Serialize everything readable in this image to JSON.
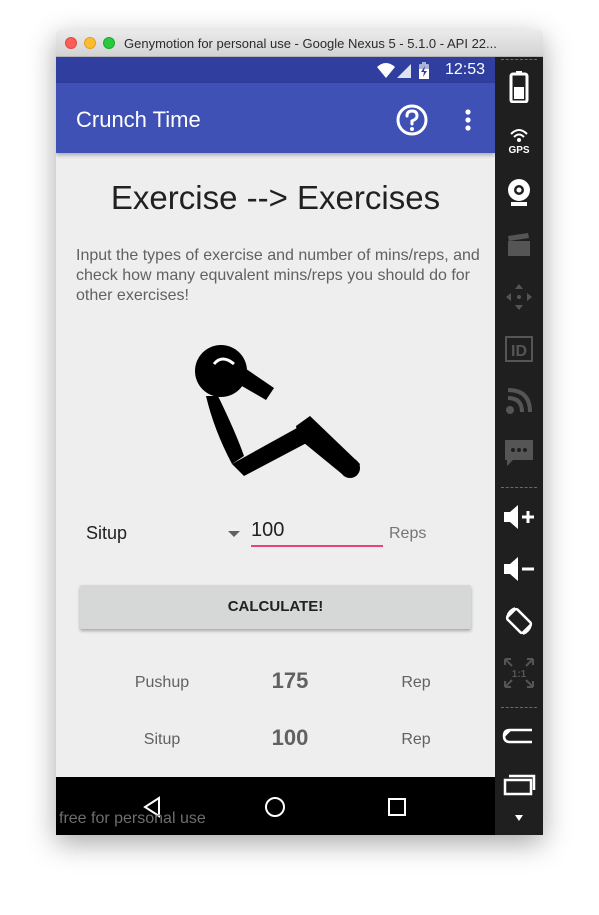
{
  "window": {
    "title": "Genymotion for personal use - Google Nexus 5 - 5.1.0 - API 22..."
  },
  "statusbar": {
    "time": "12:53"
  },
  "appbar": {
    "title": "Crunch Time",
    "help_icon": "help-circle-icon",
    "overflow_icon": "more-vert-icon"
  },
  "main": {
    "heading": "Exercise --> Exercises",
    "description": "Input the types of exercise and number of mins/reps, and check how many equvalent mins/reps you should do for other exercises!",
    "illustration_icon": "situp-figure-icon",
    "exercise_select": {
      "selected": "Situp"
    },
    "amount_input": {
      "value": "100"
    },
    "unit_label": "Reps",
    "calculate_button": "CALCULATE!",
    "results": [
      {
        "exercise": "Pushup",
        "value": "175",
        "unit": "Rep"
      },
      {
        "exercise": "Situp",
        "value": "100",
        "unit": "Rep"
      }
    ]
  },
  "navbar": {
    "back_icon": "back-triangle-icon",
    "home_icon": "home-circle-icon",
    "recents_icon": "recents-square-icon"
  },
  "watermark": "free for personal use",
  "sidebar": {
    "items": [
      "battery-icon",
      "gps-icon",
      "webcam-icon",
      "screencast-icon",
      "dpad-icon",
      "device-id-icon",
      "network-icon",
      "sms-icon",
      "volume-up-icon",
      "volume-down-icon",
      "rotate-icon",
      "pixel-perfect-icon",
      "back-icon",
      "recent-apps-icon",
      "scroll-down-icon"
    ],
    "gps_label": "GPS",
    "id_label": "ID",
    "scale_label": "1:1"
  },
  "colors": {
    "primary": "#3f51b5",
    "primary_dark": "#303f9f",
    "accent": "#ec407a"
  }
}
